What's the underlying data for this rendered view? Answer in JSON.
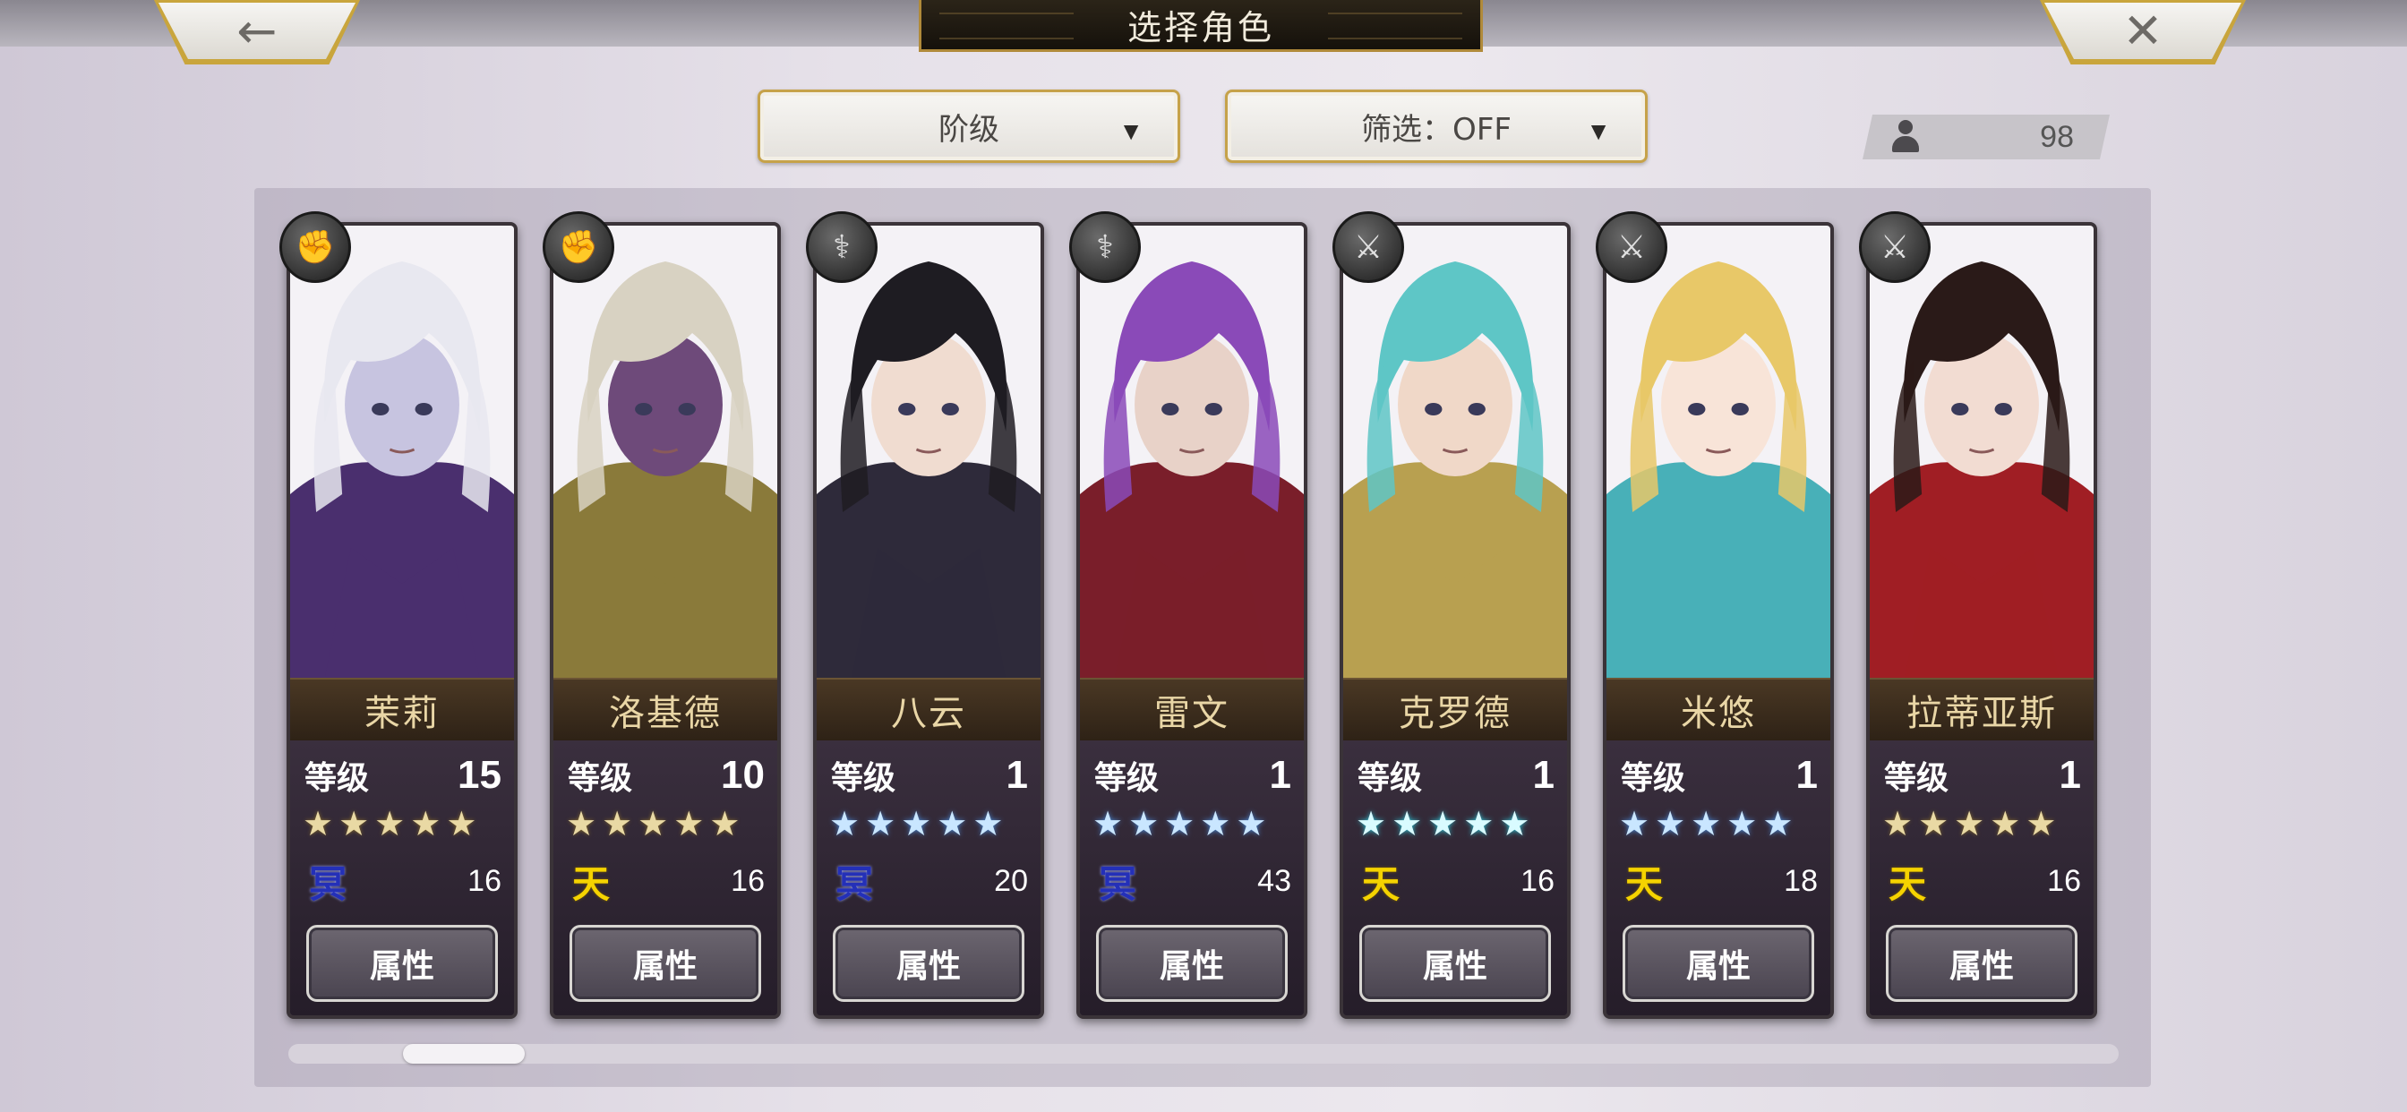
{
  "header": {
    "title": "选择角色",
    "back_icon": "arrow-left-icon",
    "close_icon": "close-icon",
    "accent": "#c9a53c"
  },
  "filters": {
    "sort_label": "阶级",
    "filter_label": "筛选：OFF"
  },
  "roster_count": "98",
  "level_label": "等级",
  "property_label": "属性",
  "attribute_glyphs": {
    "dark": "冥",
    "heaven": "天"
  },
  "characters": [
    {
      "name": "茉莉",
      "level": "15",
      "star_style": "gold",
      "attribute": "dark",
      "cost": "16",
      "class_icon": "gauntlet-icon",
      "hair": "#e8e8f0",
      "skin": "#c7c4e0",
      "outfit": "#4a2f6e"
    },
    {
      "name": "洛基德",
      "level": "10",
      "star_style": "gold",
      "attribute": "heaven",
      "cost": "16",
      "class_icon": "gauntlet-icon",
      "hair": "#d8d2c2",
      "skin": "#6e4a7a",
      "outfit": "#8a7a3a"
    },
    {
      "name": "八云",
      "level": "1",
      "star_style": "blue",
      "attribute": "dark",
      "cost": "20",
      "class_icon": "staff-icon",
      "hair": "#1e1c22",
      "skin": "#f0dcd0",
      "outfit": "#2e2a3a"
    },
    {
      "name": "雷文",
      "level": "1",
      "star_style": "blue",
      "attribute": "dark",
      "cost": "43",
      "class_icon": "staff-icon",
      "hair": "#8a4ab8",
      "skin": "#e8d2c8",
      "outfit": "#7a1e2a"
    },
    {
      "name": "克罗德",
      "level": "1",
      "star_style": "cyan",
      "attribute": "heaven",
      "cost": "16",
      "class_icon": "sword-icon",
      "hair": "#5ec6c6",
      "skin": "#f0d8c8",
      "outfit": "#b8a050"
    },
    {
      "name": "米悠",
      "level": "1",
      "star_style": "blue",
      "attribute": "heaven",
      "cost": "18",
      "class_icon": "sword-icon",
      "hair": "#e8c868",
      "skin": "#f8e4d8",
      "outfit": "#48b0b8"
    },
    {
      "name": "拉蒂亚斯",
      "level": "1",
      "star_style": "gold",
      "attribute": "heaven",
      "cost": "16",
      "class_icon": "sword-icon",
      "hair": "#2a1a18",
      "skin": "#f2dcd2",
      "outfit": "#a01e24"
    }
  ]
}
